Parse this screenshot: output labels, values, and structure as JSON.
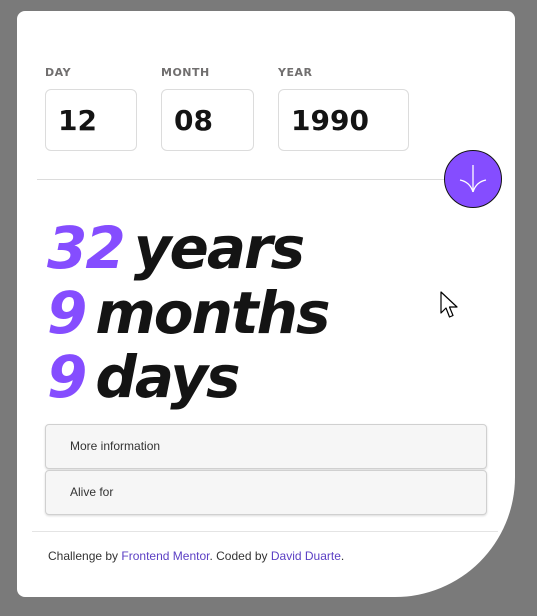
{
  "form": {
    "day": {
      "label": "DAY",
      "value": "12"
    },
    "month": {
      "label": "MONTH",
      "value": "08"
    },
    "year": {
      "label": "YEAR",
      "value": "1990"
    }
  },
  "submit_icon": "arrow-down-icon",
  "result": {
    "years_value": "32",
    "years_label": "years",
    "months_value": "9",
    "months_label": "months",
    "days_value": "9",
    "days_label": "days"
  },
  "accordions": [
    {
      "label": "More information"
    },
    {
      "label": "Alive for"
    }
  ],
  "footer": {
    "prefix": "Challenge by",
    "challenge_link": "Frontend Mentor",
    "middle": ". Coded by",
    "author_link": "David Duarte",
    "suffix": "."
  },
  "colors": {
    "accent": "#854dff",
    "text_dark": "#141414",
    "background": "#7a7a7a",
    "link": "#5b3fc4"
  }
}
